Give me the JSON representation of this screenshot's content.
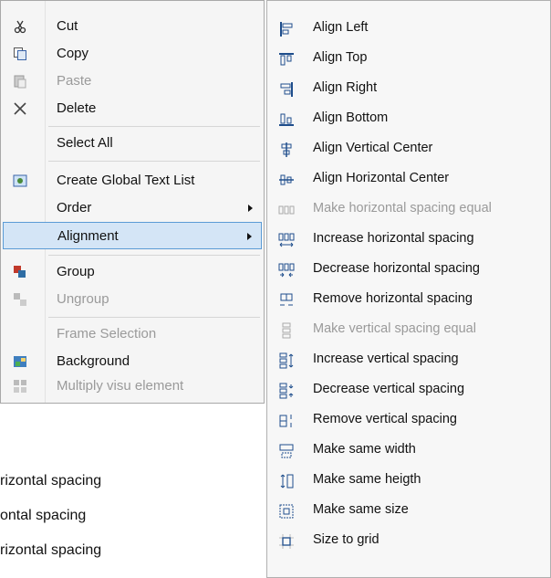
{
  "context_menu": {
    "items": [
      {
        "label": "Cut",
        "icon": "scissors-icon"
      },
      {
        "label": "Copy",
        "icon": "copy-icon"
      },
      {
        "label": "Paste",
        "icon": "paste-icon"
      },
      {
        "label": "Delete",
        "icon": "delete-x-icon"
      },
      {
        "label": "Select All"
      },
      {
        "label": "Create Global Text List",
        "icon": "global-text-list-icon"
      },
      {
        "label": "Order"
      },
      {
        "label": "Alignment"
      },
      {
        "label": "Group",
        "icon": "group-icon"
      },
      {
        "label": "Ungroup",
        "icon": "ungroup-icon"
      },
      {
        "label": "Frame Selection"
      },
      {
        "label": "Background",
        "icon": "background-icon"
      },
      {
        "label": "Multiply visu element",
        "icon": "multiply-icon"
      }
    ]
  },
  "alignment_submenu": {
    "items": [
      {
        "label": "Align Left"
      },
      {
        "label": "Align Top"
      },
      {
        "label": "Align Right"
      },
      {
        "label": "Align Bottom"
      },
      {
        "label": "Align Vertical Center"
      },
      {
        "label": "Align Horizontal Center"
      },
      {
        "label": "Make horizontal spacing equal"
      },
      {
        "label": "Increase horizontal spacing"
      },
      {
        "label": "Decrease horizontal spacing"
      },
      {
        "label": "Remove horizontal spacing"
      },
      {
        "label": "Make vertical spacing equal"
      },
      {
        "label": "Increase vertical spacing"
      },
      {
        "label": "Decrease vertical spacing"
      },
      {
        "label": "Remove vertical spacing"
      },
      {
        "label": "Make same width"
      },
      {
        "label": "Make same heigth"
      },
      {
        "label": "Make same size"
      },
      {
        "label": "Size to grid"
      }
    ]
  },
  "background_text": [
    "rizontal spacing",
    "ontal spacing",
    "rizontal spacing"
  ],
  "colors": {
    "selection_bg": "#d4e5f6",
    "selection_border": "#5b9bd5",
    "disabled_text": "#9a9a9a",
    "icon_blue": "#1f4e8c"
  }
}
